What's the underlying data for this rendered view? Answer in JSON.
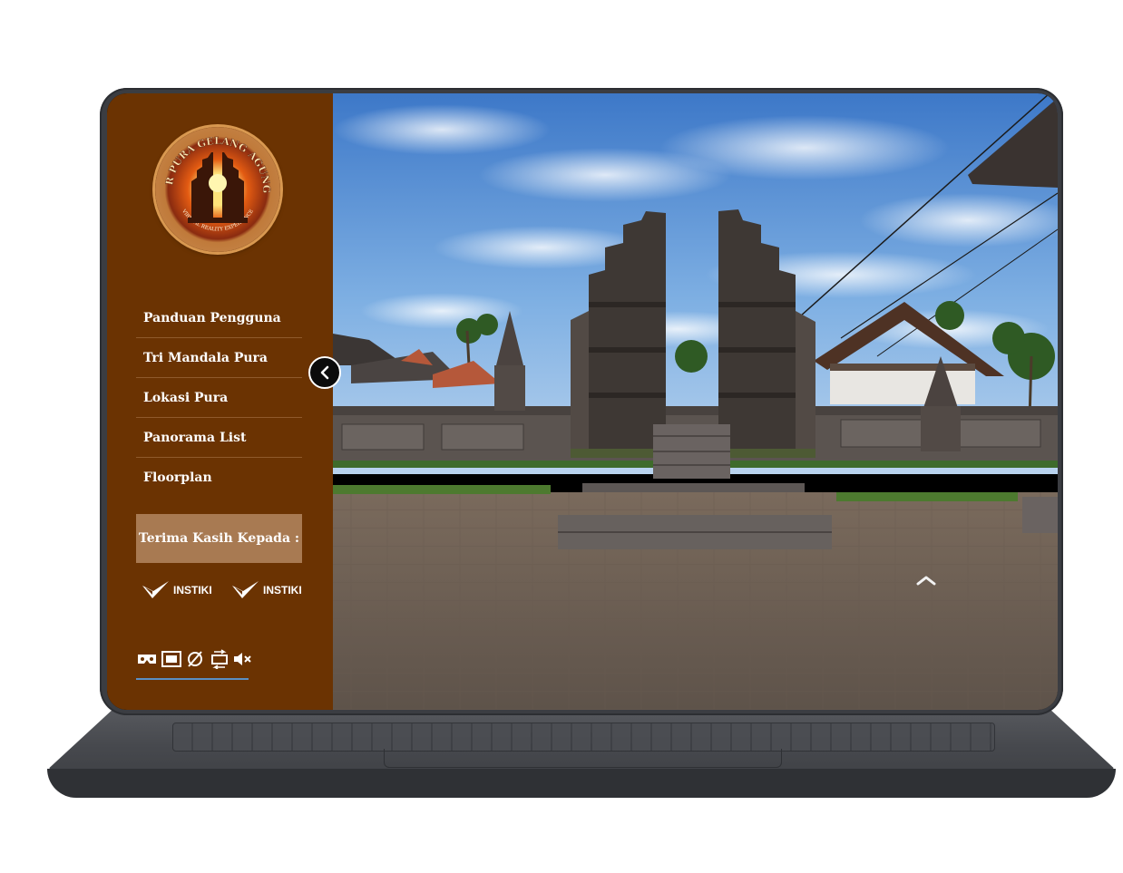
{
  "sidebar": {
    "logo": {
      "ring_top": "VR PURA GELANG AGUNG",
      "ring_bottom": "VIRTUAL REALITY EXPERIENCE"
    },
    "menu": [
      {
        "label": "Panduan Pengguna"
      },
      {
        "label": "Tri Mandala Pura"
      },
      {
        "label": "Lokasi Pura"
      },
      {
        "label": "Panorama List"
      },
      {
        "label": "Floorplan"
      }
    ],
    "thanks_label": "Terima Kasih Kepada :",
    "sponsors": [
      {
        "name": "INSTIKI"
      },
      {
        "name": "INSTIKI"
      }
    ],
    "controls": [
      {
        "icon": "vr-headset-icon"
      },
      {
        "icon": "fullscreen-icon"
      },
      {
        "icon": "gyroscope-off-icon"
      },
      {
        "icon": "autorotate-icon"
      },
      {
        "icon": "mute-icon"
      }
    ]
  },
  "panorama": {
    "scene": "temple-gate-candi-bentar",
    "hotspot": "chevron-up-icon"
  },
  "colors": {
    "sidebar_bg": "#6b3302",
    "thanks_bg": "#a87a52",
    "divider": "#8f5a2c",
    "accent_underline": "#5b8fc3",
    "laptop_body": "#3b3d42"
  }
}
